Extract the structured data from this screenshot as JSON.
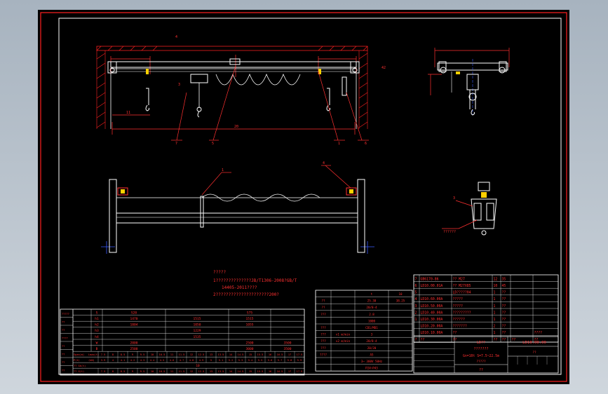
{
  "drawing": {
    "top_center_mark": "4",
    "elevation": {
      "dim_bottom": "20",
      "dim_left": "11",
      "dim_right": "42",
      "dim_small": "3"
    },
    "callouts": [
      "7",
      "5",
      "6",
      "1",
      "1",
      "4",
      "3",
      "4"
    ],
    "notes": {
      "title": "?????",
      "line1": "1??????????????JB/T1306-2008?GB/T",
      "line2": "14405-2011????",
      "line3": "2?????????????????????200?"
    },
    "part_label": "??????"
  },
  "spec_table": {
    "rows": [
      [
        "",
        "S",
        "S20",
        "",
        "S75",
        ""
      ],
      [
        "",
        "h1",
        "1470",
        "1515",
        "1515",
        ""
      ],
      [
        "",
        "h2",
        "1004",
        "1050",
        "1055",
        ""
      ],
      [
        "",
        "h3",
        "",
        "1229",
        "",
        ""
      ],
      [
        "",
        "h4",
        "",
        "1535",
        "",
        ""
      ],
      [
        "",
        "W",
        "2000",
        "",
        "2500",
        "3500"
      ],
      [
        "",
        "B",
        "2500",
        "",
        "3000",
        "3500"
      ]
    ],
    "span_row": {
      "label": "Span(m)",
      "sub": "Lmax(t)",
      "values": [
        "7.5",
        "8",
        "8.5",
        "9",
        "9.5",
        "10",
        "10.5",
        "11",
        "11.5",
        "12",
        "12.5",
        "13",
        "13.5",
        "14",
        "14.5",
        "15",
        "15.5",
        "16",
        "16.5",
        "17",
        "17.5"
      ]
    },
    "wheel_row": {
      "label": "P(t)",
      "sub": "(kN)",
      "values": [
        "3.9",
        "4",
        "4.1",
        "4.2",
        "4.3",
        "4.4",
        "4.5",
        "4.6",
        "4.7",
        "4.8",
        "4.9",
        "5",
        "5.1",
        "5.2",
        "5.3",
        "5.4",
        "5.5",
        "5.6",
        "5.7",
        "5.8",
        "5.9"
      ]
    },
    "gk_row": {
      "label": "?? Gk(t)",
      "value": "10"
    },
    "weight_row": {
      "label": "?? G(t)",
      "values": [
        "7.5",
        "8",
        "8.5",
        "9",
        "9.5",
        "10",
        "10.5",
        "11",
        "11.5",
        "12",
        "12.5",
        "13",
        "13.5",
        "14",
        "14.5",
        "15",
        "15.5",
        "16",
        "16.5",
        "17",
        "17.5"
      ]
    },
    "left_column": [
      "?????",
      "??",
      "??",
      "????",
      "??",
      "??",
      "??",
      "??"
    ]
  },
  "param_table": {
    "header": [
      "",
      "",
      "t",
      "10"
    ],
    "rows": [
      [
        "??",
        "",
        "25.30",
        "38.25"
      ],
      [
        "??",
        "",
        "20/8-4",
        ""
      ],
      [
        "???",
        "",
        "2.8",
        ""
      ],
      [
        "",
        "",
        "1000",
        ""
      ],
      [
        "???",
        "",
        "CD1/MD1",
        ""
      ],
      [
        "???",
        "v1 m/min",
        "3",
        ""
      ],
      [
        "???",
        "v2 m/min",
        "20/8-4",
        ""
      ],
      [
        "???",
        "",
        "20/20",
        ""
      ],
      [
        "????",
        "",
        "A5",
        ""
      ],
      [
        "",
        "",
        "3~ 380V 50Hz",
        ""
      ],
      [
        "",
        "",
        "P24~P43",
        ""
      ]
    ]
  },
  "bom": {
    "rows": [
      [
        "7",
        "GB6170-86",
        "?? M27",
        "12",
        "35",
        "",
        ""
      ],
      [
        "6",
        "LD10.00.01A",
        "?? M27X85",
        "10",
        "45",
        "",
        ""
      ],
      [
        "5",
        "",
        "LD?????04",
        "1",
        "??",
        "",
        ""
      ],
      [
        "4",
        "LD10.60.00A",
        "?????",
        "1",
        "??",
        "",
        ""
      ],
      [
        "3",
        "LD10.50.00A",
        "?????",
        "1",
        "??",
        "",
        ""
      ],
      [
        "2",
        "LD10.40.00A",
        "?????????",
        "1",
        "??",
        "",
        ""
      ],
      [
        "1",
        "LD10.30.00A",
        "??????",
        "1",
        "??",
        "",
        ""
      ],
      [
        "",
        "LD10.20.00A",
        "???????",
        "2",
        "??",
        "",
        ""
      ],
      [
        "",
        "LD10.10.00A",
        "??",
        "1",
        "??",
        "",
        "????"
      ]
    ],
    "header": [
      "?",
      "??",
      "??",
      "??",
      "??",
      "??",
      "??"
    ]
  },
  "title_block": {
    "drawing_no": "LD10.00.00",
    "product": "LD?? ???????",
    "model": "Gn=10t S=7.5~22.5m",
    "scale": "?????",
    "sheet": "??",
    "company": "??"
  },
  "colors": {
    "line": "#ffffff",
    "dim": "#ff3030",
    "hatch": "#ff2020",
    "border": "#ff2020",
    "accent": "#ffd000",
    "construction": "#3a5cff",
    "paper": "#000000",
    "background": "#b9c2cc"
  }
}
